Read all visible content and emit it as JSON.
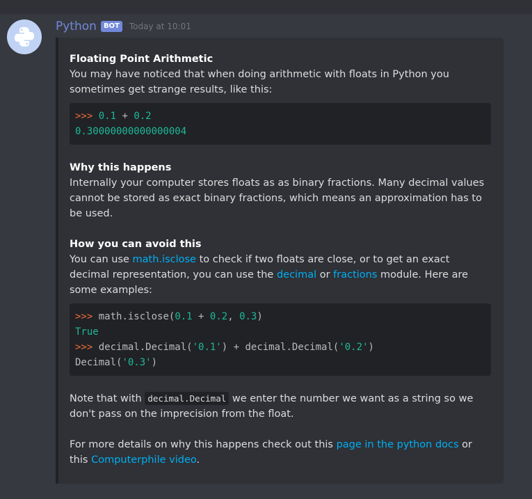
{
  "author": {
    "name": "Python",
    "badge": "BOT",
    "timestamp": "Today at 10:01"
  },
  "embed": {
    "section1": {
      "title": "Floating Point Arithmetic",
      "text": "You may have noticed that when doing arithmetic with floats in Python you sometimes get strange results, like this:",
      "code": [
        {
          "prompt": ">>>",
          "segments": [
            {
              "t": "num",
              "v": "0.1"
            },
            {
              "t": "op",
              "v": " + "
            },
            {
              "t": "num",
              "v": "0.2"
            }
          ]
        },
        {
          "prompt": "",
          "segments": [
            {
              "t": "num",
              "v": "0.30000000000000004"
            }
          ]
        }
      ]
    },
    "section2": {
      "title": "Why this happens",
      "text": "Internally your computer stores floats as as binary fractions. Many decimal values cannot be stored as exact binary fractions, which means an approximation has to be used."
    },
    "section3": {
      "title": "How you can avoid this",
      "text_parts": [
        {
          "t": "text",
          "v": "You can use "
        },
        {
          "t": "link",
          "v": "math.isclose"
        },
        {
          "t": "text",
          "v": " to check if two floats are close, or to get an exact decimal representation, you can use the "
        },
        {
          "t": "link",
          "v": "decimal"
        },
        {
          "t": "text",
          "v": " or "
        },
        {
          "t": "link",
          "v": "fractions"
        },
        {
          "t": "text",
          "v": " module. Here are some examples:"
        }
      ],
      "code": [
        {
          "prompt": ">>>",
          "segments": [
            {
              "t": "op",
              "v": " math.isclose("
            },
            {
              "t": "num",
              "v": "0.1"
            },
            {
              "t": "op",
              "v": " + "
            },
            {
              "t": "num",
              "v": "0.2"
            },
            {
              "t": "op",
              "v": ", "
            },
            {
              "t": "num",
              "v": "0.3"
            },
            {
              "t": "op",
              "v": ")"
            }
          ]
        },
        {
          "prompt": "",
          "segments": [
            {
              "t": "kw",
              "v": "True"
            }
          ]
        },
        {
          "prompt": ">>>",
          "segments": [
            {
              "t": "op",
              "v": " decimal.Decimal("
            },
            {
              "t": "str",
              "v": "'0.1'"
            },
            {
              "t": "op",
              "v": ") + decimal.Decimal("
            },
            {
              "t": "str",
              "v": "'0.2'"
            },
            {
              "t": "op",
              "v": ")"
            }
          ]
        },
        {
          "prompt": "",
          "segments": [
            {
              "t": "op",
              "v": "Decimal("
            },
            {
              "t": "str",
              "v": "'0.3'"
            },
            {
              "t": "op",
              "v": ")"
            }
          ]
        }
      ]
    },
    "section4": {
      "text_parts": [
        {
          "t": "text",
          "v": "Note that with "
        },
        {
          "t": "inline",
          "v": "decimal.Decimal"
        },
        {
          "t": "text",
          "v": " we enter the number we want as a string so we don't pass on the imprecision from the float."
        }
      ]
    },
    "section5": {
      "text_parts": [
        {
          "t": "text",
          "v": "For more details on why this happens check out this "
        },
        {
          "t": "link",
          "v": "page in the python docs"
        },
        {
          "t": "text",
          "v": " or this "
        },
        {
          "t": "link",
          "v": "Computerphile video"
        },
        {
          "t": "text",
          "v": "."
        }
      ]
    }
  },
  "colors": {
    "background": "#36393f",
    "embed_bg": "#2f3136",
    "code_bg": "#202225",
    "link": "#00aff4",
    "username": "#7289da",
    "prompt": "#f26c3b",
    "number": "#1fb89a"
  },
  "icons": {
    "avatar": "python-logo-icon"
  }
}
